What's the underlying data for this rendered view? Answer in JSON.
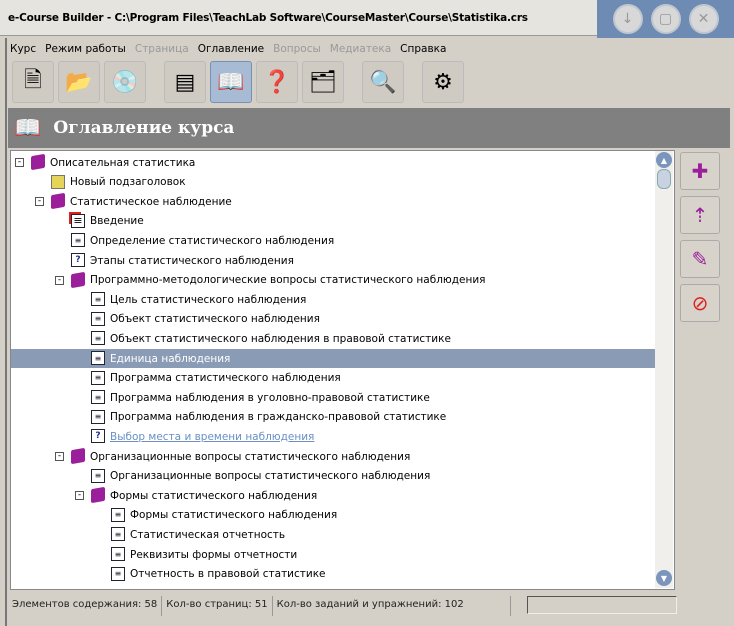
{
  "window": {
    "title": "e-Course Builder - C:\\Program Files\\TeachLab Software\\CourseMaster\\Course\\Statistika.crs",
    "buttons": [
      "minimize",
      "maximize",
      "close"
    ]
  },
  "menu": [
    {
      "label": "Курс",
      "enabled": true
    },
    {
      "label": "Режим работы",
      "enabled": true
    },
    {
      "label": "Страница",
      "enabled": false
    },
    {
      "label": "Оглавление",
      "enabled": true
    },
    {
      "label": "Вопросы",
      "enabled": false
    },
    {
      "label": "Медиатека",
      "enabled": false
    },
    {
      "label": "Справка",
      "enabled": true
    }
  ],
  "toolbar": [
    {
      "icon": "new-course-icon"
    },
    {
      "icon": "open-course-icon"
    },
    {
      "icon": "publish-cd-icon"
    },
    {
      "sep": true
    },
    {
      "icon": "page-editor-icon"
    },
    {
      "icon": "contents-book-icon",
      "active": true
    },
    {
      "icon": "questions-icon"
    },
    {
      "icon": "media-library-icon"
    },
    {
      "sep": true
    },
    {
      "icon": "preview-icon"
    },
    {
      "sep": true
    },
    {
      "icon": "settings-icon"
    }
  ],
  "header": {
    "title": "Оглавление курса"
  },
  "tree": [
    {
      "level": 0,
      "icon": "book",
      "exp": "-",
      "label": "Описательная статистика"
    },
    {
      "level": 1,
      "icon": "folder",
      "label": "Новый подзаголовок"
    },
    {
      "level": 1,
      "icon": "book",
      "exp": "-",
      "label": "Статистическое наблюдение"
    },
    {
      "level": 2,
      "icon": "red",
      "label": "Введение"
    },
    {
      "level": 2,
      "icon": "page",
      "label": "Определение статистического наблюдения"
    },
    {
      "level": 2,
      "icon": "q",
      "label": "Этапы статистического наблюдения"
    },
    {
      "level": 2,
      "icon": "book",
      "exp": "-",
      "label": "Программно-методологические вопросы статистического наблюдения"
    },
    {
      "level": 3,
      "icon": "page",
      "label": "Цель статистического наблюдения"
    },
    {
      "level": 3,
      "icon": "page",
      "label": "Объект статистического наблюдения"
    },
    {
      "level": 3,
      "icon": "page",
      "label": "Объект статистического наблюдения в правовой статистике"
    },
    {
      "level": 3,
      "icon": "page",
      "label": "Единица наблюдения",
      "selected": true
    },
    {
      "level": 3,
      "icon": "page",
      "label": "Программа статистического наблюдения"
    },
    {
      "level": 3,
      "icon": "page",
      "label": "Программа наблюдения в уголовно-правовой статистике"
    },
    {
      "level": 3,
      "icon": "page",
      "label": "Программа наблюдения в гражданско-правовой статистике"
    },
    {
      "level": 3,
      "icon": "q",
      "label": "Выбор места и времени наблюдения",
      "link": true
    },
    {
      "level": 2,
      "icon": "book",
      "exp": "-",
      "label": "Организационные вопросы статистического наблюдения"
    },
    {
      "level": 3,
      "icon": "page",
      "label": "Организационные вопросы статистического наблюдения"
    },
    {
      "level": 3,
      "icon": "book",
      "exp": "-",
      "label": "Формы статистического наблюдения"
    },
    {
      "level": 4,
      "icon": "page",
      "label": "Формы статистического наблюдения"
    },
    {
      "level": 4,
      "icon": "page",
      "label": "Статистическая отчетность"
    },
    {
      "level": 4,
      "icon": "page",
      "label": "Реквизиты формы отчетности"
    },
    {
      "level": 4,
      "icon": "page",
      "label": "Отчетность в правовой статистике"
    }
  ],
  "side_buttons": [
    {
      "icon": "add-item-icon",
      "glyph": "✚"
    },
    {
      "icon": "add-subitem-icon",
      "glyph": "⇡"
    },
    {
      "icon": "edit-item-icon",
      "glyph": "✎"
    },
    {
      "icon": "delete-item-icon",
      "glyph": "⊘"
    }
  ],
  "status": {
    "elements": "Элементов содержания: 58",
    "pages": "Кол-во страниц: 51",
    "tasks": "Кол-во заданий и упражнений: 102"
  }
}
